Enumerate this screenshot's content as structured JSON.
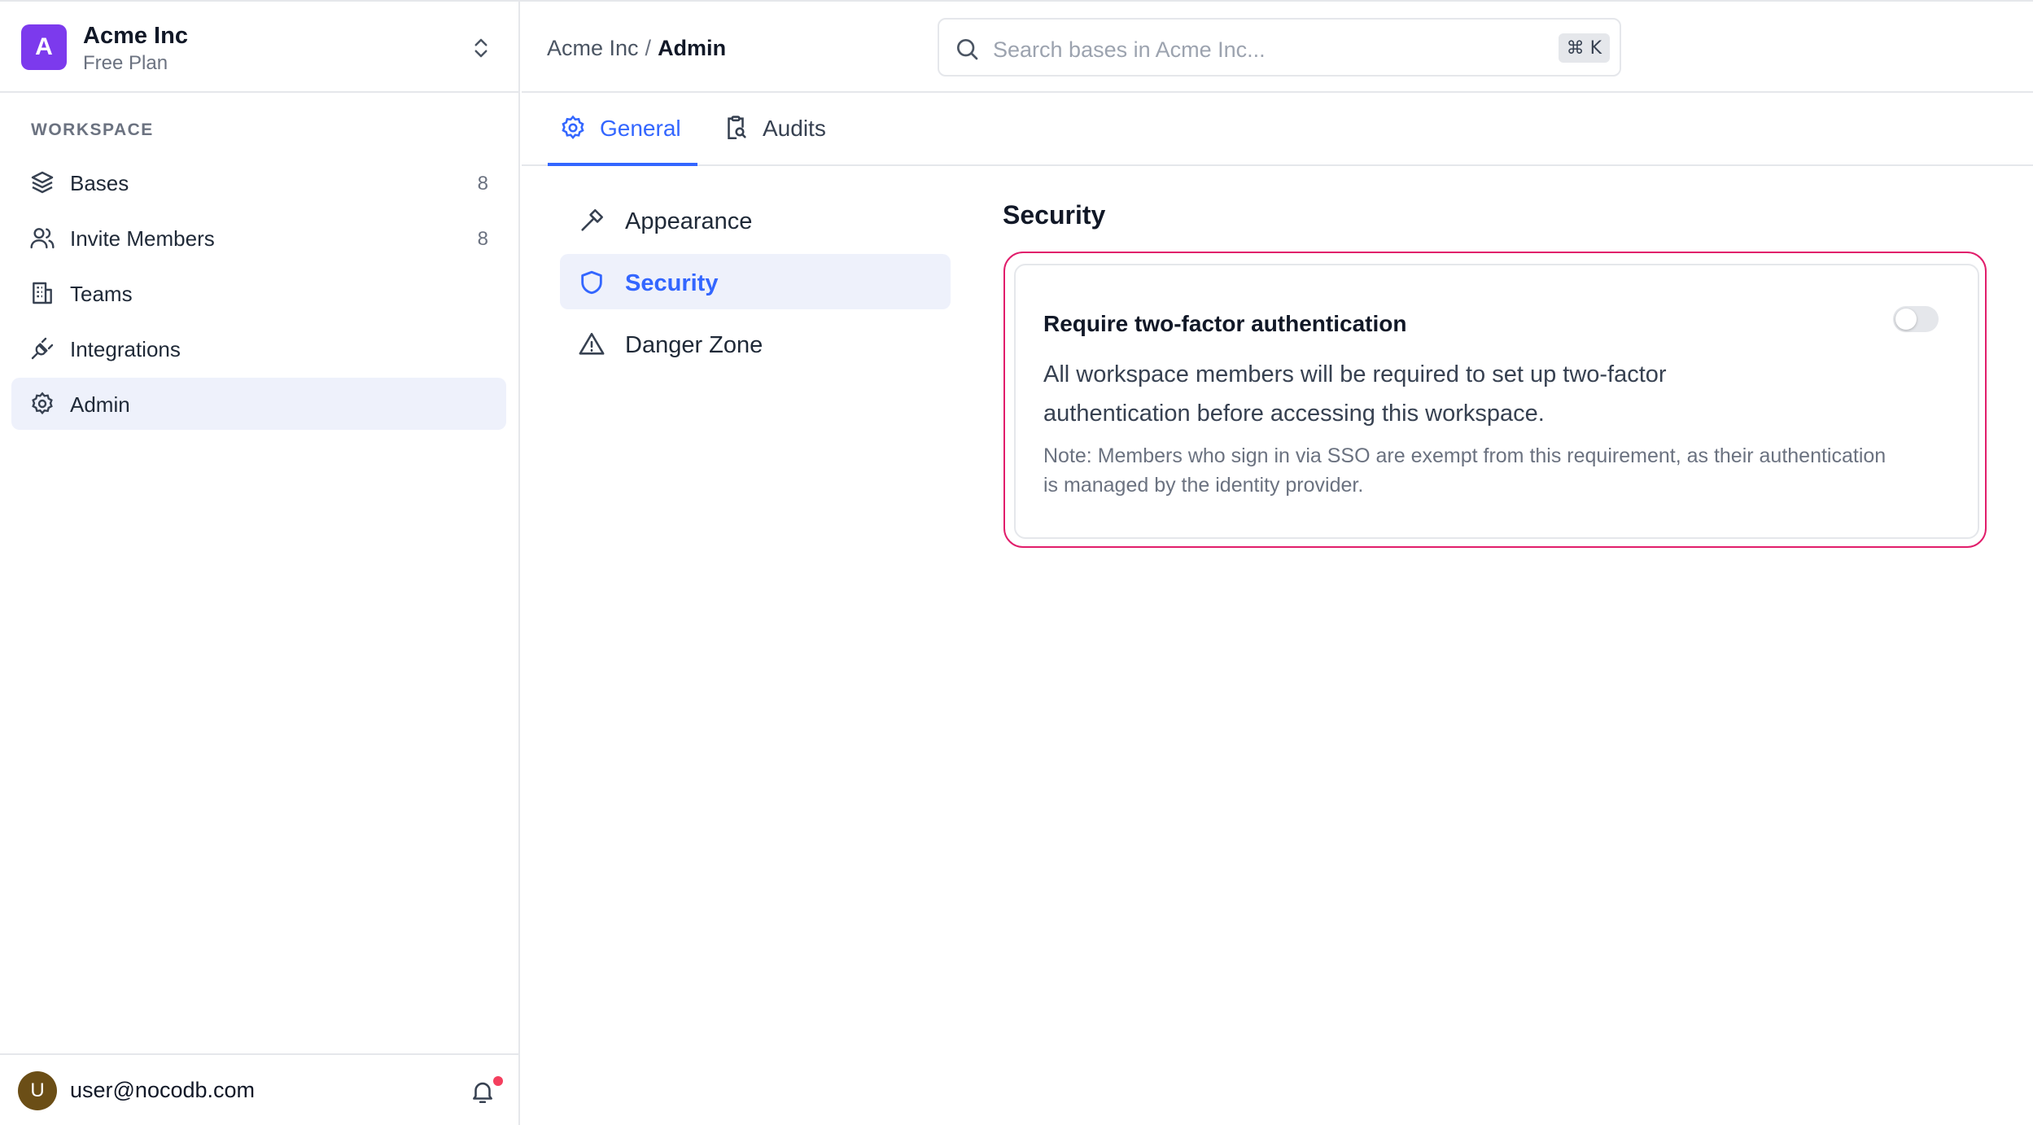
{
  "workspace": {
    "initial": "A",
    "name": "Acme Inc",
    "plan": "Free Plan"
  },
  "sidebar": {
    "section_title": "WORKSPACE",
    "items": [
      {
        "label": "Bases",
        "count": "8"
      },
      {
        "label": "Invite Members",
        "count": "8"
      },
      {
        "label": "Teams"
      },
      {
        "label": "Integrations"
      },
      {
        "label": "Admin"
      }
    ]
  },
  "user": {
    "initial": "U",
    "email": "user@nocodb.com"
  },
  "breadcrumb": {
    "parent": "Acme Inc",
    "separator": "/",
    "current": "Admin"
  },
  "search": {
    "placeholder": "Search bases in Acme Inc...",
    "shortcut": "⌘ K"
  },
  "tabs": [
    {
      "label": "General"
    },
    {
      "label": "Audits"
    }
  ],
  "submenu": [
    {
      "label": "Appearance"
    },
    {
      "label": "Security"
    },
    {
      "label": "Danger Zone"
    }
  ],
  "security": {
    "heading": "Security",
    "card": {
      "title": "Require two-factor authentication",
      "description": "All workspace members will be required to set up two-factor authentication before accessing this workspace.",
      "note": "Note: Members who sign in via SSO are exempt from this requirement, as their authentication is managed by the identity provider.",
      "toggle_on": false
    }
  },
  "colors": {
    "accent": "#3366ff",
    "logo": "#7c3aed",
    "highlight": "#e11d6b",
    "notification": "#f43f5e"
  }
}
